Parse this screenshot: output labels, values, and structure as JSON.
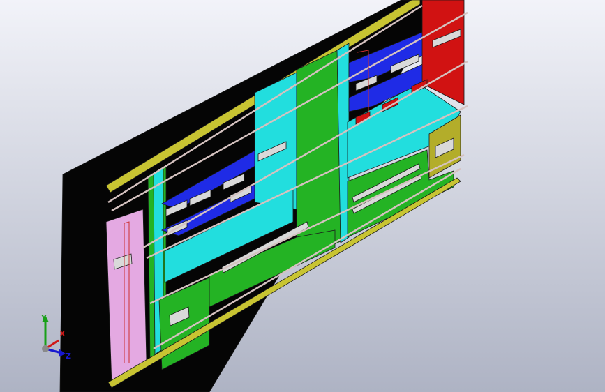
{
  "viewport": {
    "background_top": "#f2f3f9",
    "background_bottom": "#aeb3c4"
  },
  "model": {
    "colors": {
      "back_panel": "#050505",
      "rail": "#c8c432",
      "rod": "#d5c2c0",
      "green": "#24b324",
      "cyan": "#22dede",
      "cyan_light": "#9fe8e8",
      "blue": "#1f2be6",
      "red": "#d11212",
      "olive": "#b3ad2a",
      "pink": "#e4a9e2",
      "gray_part": "#d9d9d9",
      "outline": "#1a1a1a"
    }
  },
  "triad": {
    "x_label": "X",
    "y_label": "Y",
    "z_label": "Z",
    "x_color": "#d01818",
    "y_color": "#18a018",
    "z_color": "#1818d0"
  }
}
